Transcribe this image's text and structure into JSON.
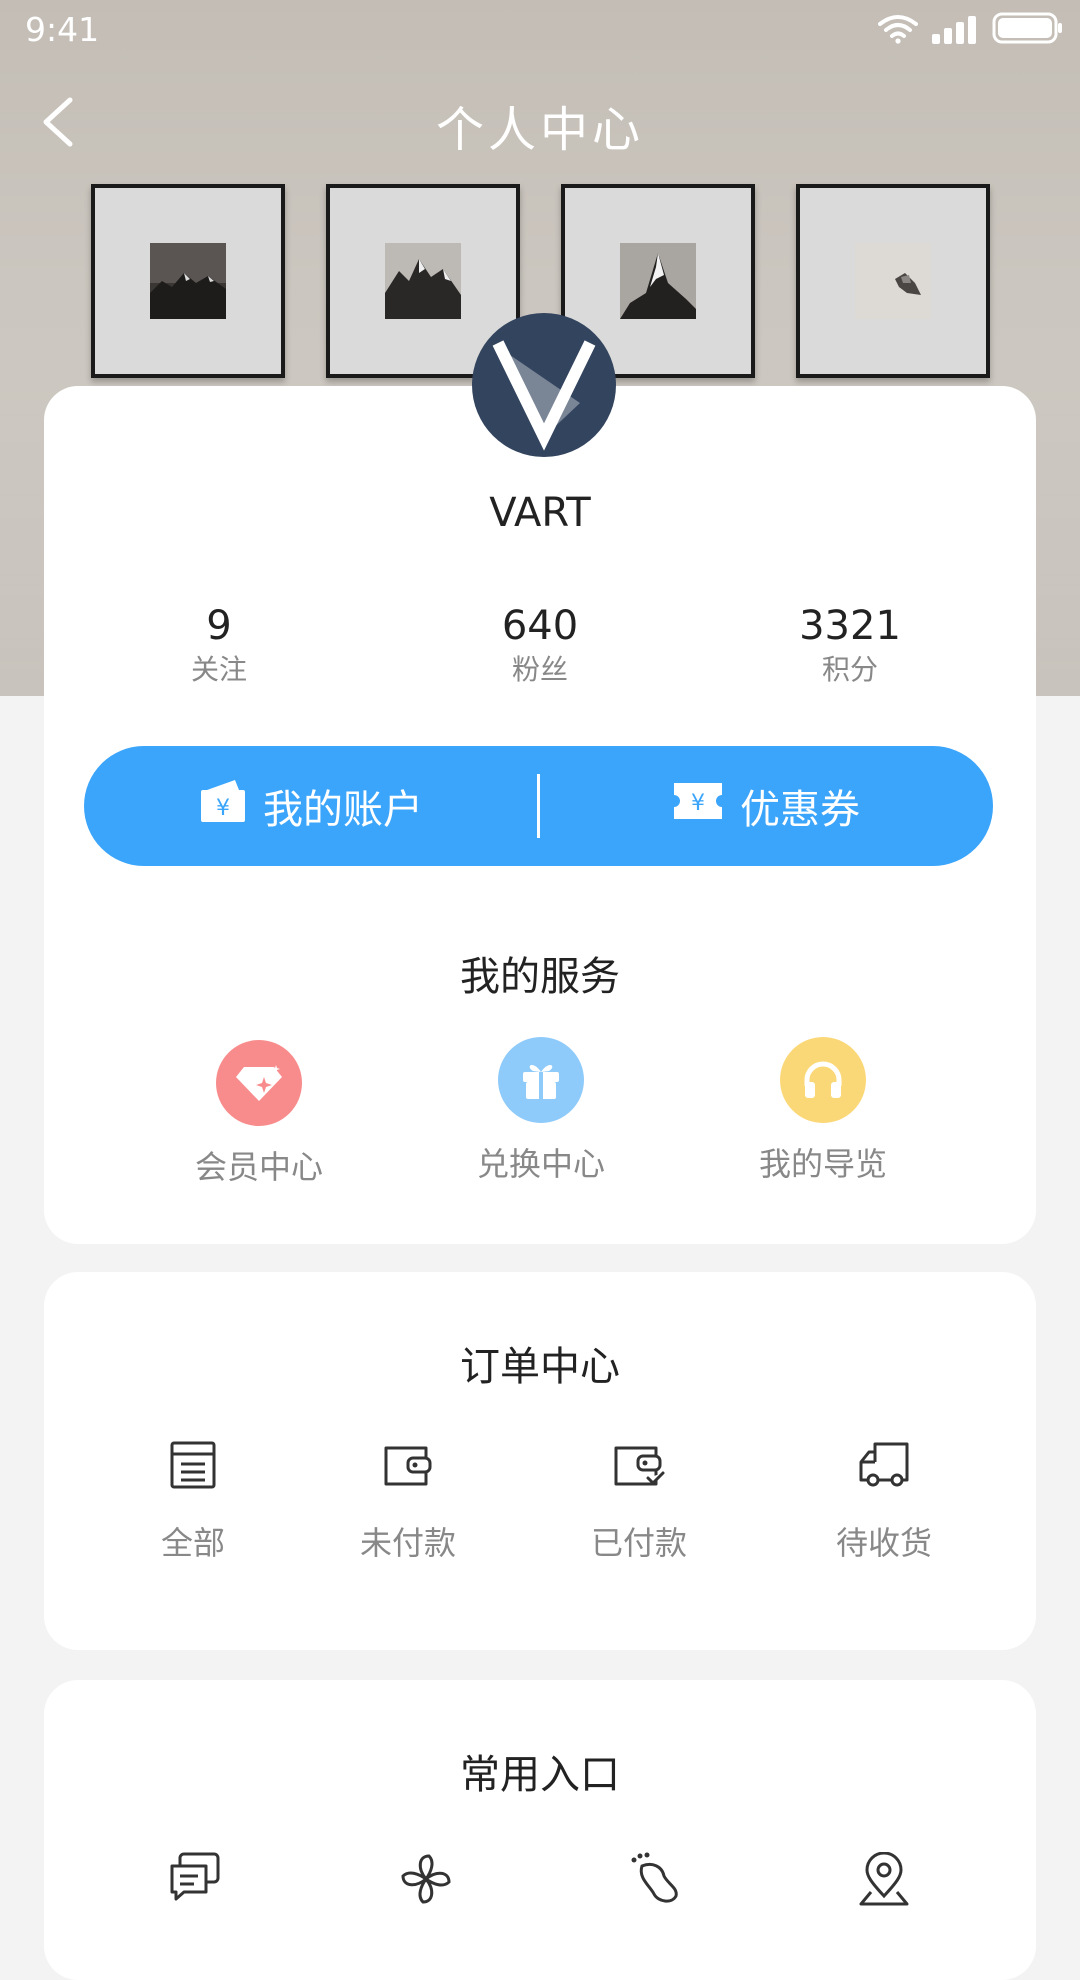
{
  "status_bar": {
    "time": "9:41"
  },
  "nav": {
    "title": "个人中心"
  },
  "profile": {
    "username": "VART",
    "stats": [
      {
        "value": "9",
        "label": "关注"
      },
      {
        "value": "640",
        "label": "粉丝"
      },
      {
        "value": "3321",
        "label": "积分"
      }
    ]
  },
  "account_bar": {
    "account_label": "我的账户",
    "coupon_label": "优惠券"
  },
  "services": {
    "title": "我的服务",
    "items": [
      {
        "label": "会员中心",
        "icon": "diamond-icon",
        "color": "#f88c8c"
      },
      {
        "label": "兑换中心",
        "icon": "gift-icon",
        "color": "#8ecbfb"
      },
      {
        "label": "我的导览",
        "icon": "headphones-icon",
        "color": "#fbd877"
      }
    ]
  },
  "orders": {
    "title": "订单中心",
    "items": [
      {
        "label": "全部",
        "icon": "list-document-icon"
      },
      {
        "label": "未付款",
        "icon": "wallet-icon"
      },
      {
        "label": "已付款",
        "icon": "wallet-check-icon"
      },
      {
        "label": "待收货",
        "icon": "delivery-truck-icon"
      }
    ]
  },
  "shortcuts": {
    "title": "常用入口",
    "items": [
      {
        "icon": "message-icon"
      },
      {
        "icon": "pinwheel-icon"
      },
      {
        "icon": "footprint-icon"
      },
      {
        "icon": "location-pin-icon"
      }
    ]
  },
  "colors": {
    "accent": "#3ba5fb",
    "avatar_bg": "#33445f",
    "page_bg": "#f3f3f3"
  }
}
